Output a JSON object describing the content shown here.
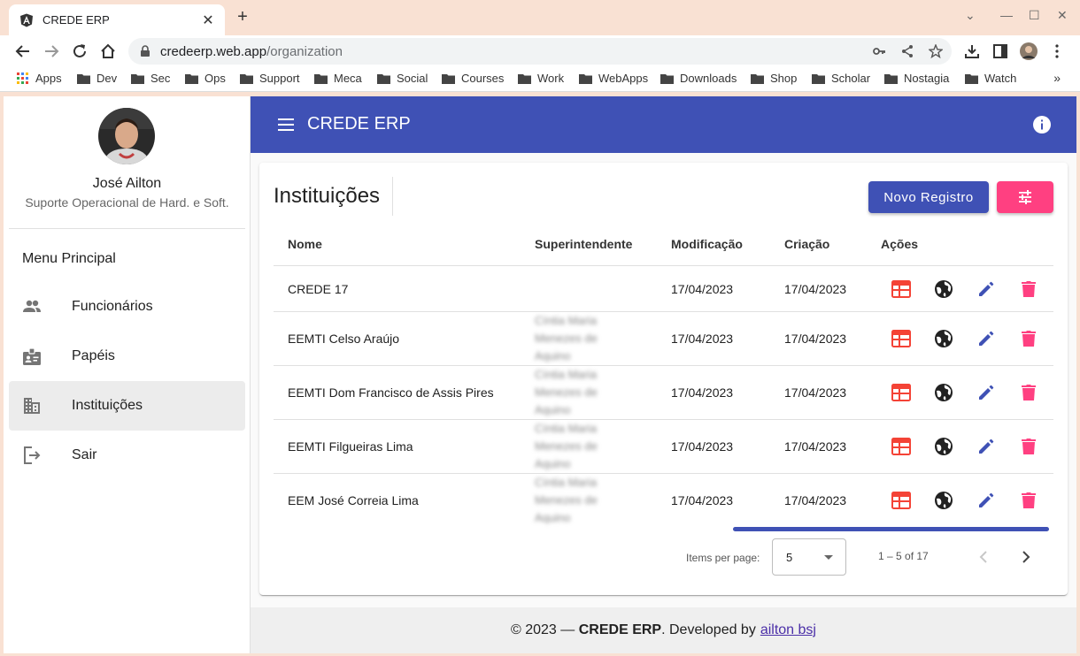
{
  "browser": {
    "tab_title": "CREDE ERP",
    "url_host": "credeerp.web.app",
    "url_path": "/organization",
    "bookmarks": [
      "Apps",
      "Dev",
      "Sec",
      "Ops",
      "Support",
      "Meca",
      "Social",
      "Courses",
      "Work",
      "WebApps",
      "Downloads",
      "Shop",
      "Scholar",
      "Nostagia",
      "Watch"
    ],
    "bookmark_more": "»"
  },
  "sidebar": {
    "user_name": "José Ailton",
    "user_role": "Suporte Operacional de Hard. e Soft.",
    "menu_heading": "Menu Principal",
    "items": [
      {
        "label": "Funcionários",
        "icon": "people-icon"
      },
      {
        "label": "Papéis",
        "icon": "badge-icon"
      },
      {
        "label": "Instituições",
        "icon": "business-icon",
        "active": true
      },
      {
        "label": "Sair",
        "icon": "logout-icon"
      }
    ]
  },
  "appbar": {
    "title": "CREDE ERP"
  },
  "card": {
    "title": "Instituições",
    "new_button": "Novo Registro",
    "columns": [
      "Nome",
      "Superintendente",
      "Modificação",
      "Criação",
      "Ações"
    ],
    "rows": [
      {
        "name": "CREDE 17",
        "superintendent": "",
        "modified": "17/04/2023",
        "created": "17/04/2023"
      },
      {
        "name": "EEMTI Celso Araújo",
        "superintendent": "Cíntia Maria Menezes de Aquino",
        "modified": "17/04/2023",
        "created": "17/04/2023"
      },
      {
        "name": "EEMTI Dom Francisco de Assis Pires",
        "superintendent": "Cíntia Maria Menezes de Aquino",
        "modified": "17/04/2023",
        "created": "17/04/2023"
      },
      {
        "name": "EEMTI Filgueiras Lima",
        "superintendent": "Cíntia Maria Menezes de Aquino",
        "modified": "17/04/2023",
        "created": "17/04/2023"
      },
      {
        "name": "EEM José Correia Lima",
        "superintendent": "Cíntia Maria Menezes de Aquino",
        "modified": "17/04/2023",
        "created": "17/04/2023"
      }
    ],
    "colors": {
      "primary": "#3f51b5",
      "accent": "#ff4081",
      "warn": "#f44336"
    }
  },
  "paginator": {
    "label": "Items per page:",
    "page_size": "5",
    "range": "1 – 5 of 17"
  },
  "footer": {
    "prefix": "© 2023 —",
    "brand": "CREDE ERP",
    "middle": ". Developed by",
    "link": "ailton bsj"
  }
}
